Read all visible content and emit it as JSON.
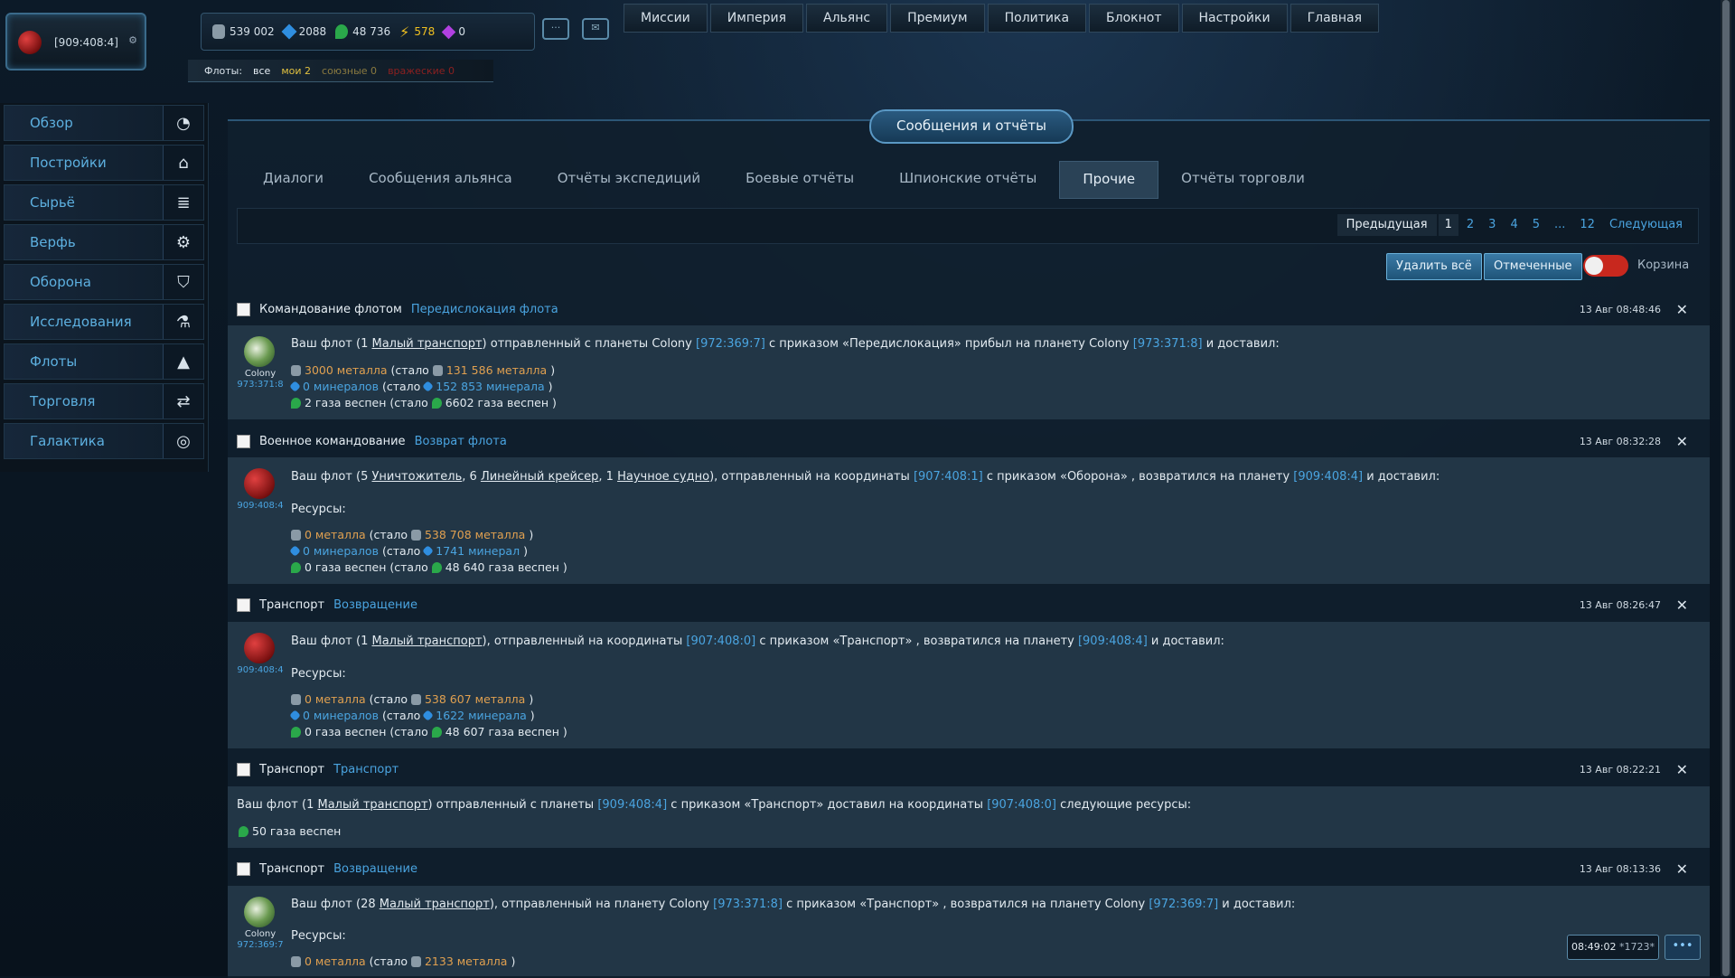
{
  "planet": {
    "coord": "[909:408:4]"
  },
  "resources": {
    "metal": "539 002",
    "crystal": "2088",
    "gas": "48 736",
    "energy": "578",
    "premium": "0"
  },
  "fleets": {
    "label": "Флоты:",
    "all": "все",
    "mine": "мои 2",
    "allied": "союзные 0",
    "hostile": "вражеские 0"
  },
  "topmenu": [
    "Миссии",
    "Империя",
    "Альянс",
    "Премиум",
    "Политика",
    "Блокнот",
    "Настройки",
    "Главная"
  ],
  "sidebar": [
    {
      "label": "Обзор",
      "icon": "overview-icon"
    },
    {
      "label": "Постройки",
      "icon": "buildings-icon"
    },
    {
      "label": "Сырьё",
      "icon": "resources-icon"
    },
    {
      "label": "Верфь",
      "icon": "shipyard-icon"
    },
    {
      "label": "Оборона",
      "icon": "defense-icon"
    },
    {
      "label": "Исследования",
      "icon": "research-icon"
    },
    {
      "label": "Флоты",
      "icon": "fleets-icon"
    },
    {
      "label": "Торговля",
      "icon": "trade-icon"
    },
    {
      "label": "Галактика",
      "icon": "galaxy-icon"
    }
  ],
  "page_title": "Сообщения и отчёты",
  "tabs": [
    "Диалоги",
    "Сообщения альянса",
    "Отчёты экспедиций",
    "Боевые отчёты",
    "Шпионские отчёты",
    "Прочие",
    "Отчёты торговли"
  ],
  "pager": {
    "prev": "Предыдущая",
    "pages": [
      "1",
      "2",
      "3",
      "4",
      "5",
      "...",
      "12"
    ],
    "next": "Следующая"
  },
  "actions": {
    "delete_all": "Удалить всё",
    "marked": "Отмеченные",
    "trash": "Корзина"
  },
  "messages": [
    {
      "sender": "Командование флотом",
      "subject": "Передислокация флота",
      "date": "13 Авг 08:48:46",
      "avatar_label": "Colony",
      "avatar_coord": "973:371:8",
      "t1": "Ваш флот (1 ",
      "ship": "Малый транспорт",
      "t2": ") отправленный с планеты Colony ",
      "c1": "[972:369:7]",
      "t3": " с приказом «Передислокация» прибыл на планету Colony ",
      "c2": "[973:371:8]",
      "t4": " и доставил:",
      "r1": "3000 металла",
      "r1b": "131 586 металла",
      "r2": "0 минералов",
      "r2b": "152 853 минерала",
      "r3": "2 газа веспен",
      "r3b": "6602 газа веспен"
    },
    {
      "sender": "Военное командование",
      "subject": "Возврат флота",
      "date": "13 Авг 08:32:28",
      "avatar_coord": "909:408:4",
      "t1": "Ваш флот (5 ",
      "s1": "Уничтожитель",
      "t1b": ", 6 ",
      "s2": "Линейный крейсер",
      "t1c": ", 1 ",
      "s3": "Научное судно",
      "t2": "), отправленный на координаты ",
      "c1": "[907:408:1]",
      "t3": " с приказом «Оборона» , возвратился на планету ",
      "c2": "[909:408:4]",
      "t4": " и доставил:",
      "res_label": "Ресурсы:",
      "r1": "0 металла",
      "r1b": "538 708 металла",
      "r2": "0 минералов",
      "r2b": "1741 минерал",
      "r3": "0 газа веспен",
      "r3b": "48 640 газа веспен"
    },
    {
      "sender": "Транспорт",
      "subject": "Возвращение",
      "date": "13 Авг 08:26:47",
      "avatar_coord": "909:408:4",
      "t1": "Ваш флот (1 ",
      "ship": "Малый транспорт",
      "t2": "), отправленный на координаты ",
      "c1": "[907:408:0]",
      "t3": " с приказом «Транспорт» , возвратился на планету ",
      "c2": "[909:408:4]",
      "t4": " и доставил:",
      "res_label": "Ресурсы:",
      "r1": "0 металла",
      "r1b": "538 607 металла",
      "r2": "0 минералов",
      "r2b": "1622 минерала",
      "r3": "0 газа веспен",
      "r3b": "48 607 газа веспен"
    },
    {
      "sender": "Транспорт",
      "subject": "Транспорт",
      "date": "13 Авг 08:22:21",
      "t1": "Ваш флот (1 ",
      "ship": "Малый транспорт",
      "t2": ") отправленный с планеты ",
      "c1": "[909:408:4]",
      "t3": " с приказом «Транспорт» доставил на координаты ",
      "c2": "[907:408:0]",
      "t4": " следующие ресурсы:",
      "r1": "50 газа веспен"
    },
    {
      "sender": "Транспорт",
      "subject": "Возвращение",
      "date": "13 Авг 08:13:36",
      "avatar_label": "Colony",
      "avatar_coord": "972:369:7",
      "t1": "Ваш флот (28 ",
      "ship": "Малый транспорт",
      "t2": "), отправленный на планету Colony ",
      "c1": "[973:371:8]",
      "t3": " с приказом «Транспорт» , возвратился на планету Colony ",
      "c2": "[972:369:7]",
      "t4": " и доставил:",
      "res_label": "Ресурсы:",
      "r1": "0 металла",
      "r1b": "2133 металла"
    }
  ],
  "clock": {
    "time": "08:49:02",
    "extra": "*1723*"
  },
  "labels": {
    "was_open": "(стало ",
    "close_paren": ")"
  }
}
